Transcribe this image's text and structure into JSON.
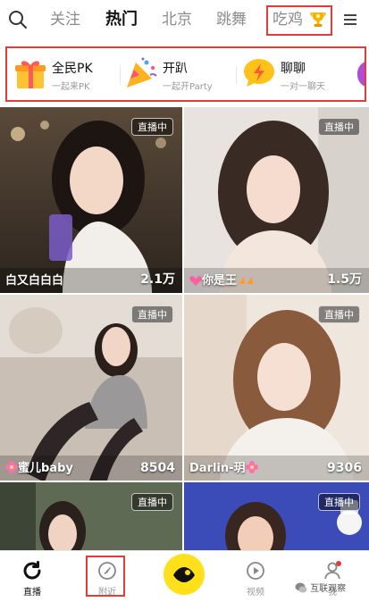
{
  "top_nav": {
    "tabs": [
      {
        "label": "关注"
      },
      {
        "label": "热门",
        "active": true
      },
      {
        "label": "北京"
      },
      {
        "label": "跳舞"
      },
      {
        "label": "吃鸡"
      }
    ],
    "icons": {
      "left": "search-icon",
      "trophy": "trophy-icon",
      "right": "menu-icon"
    },
    "highlight_color": "#e23b3b"
  },
  "categories": [
    {
      "name": "全民PK",
      "subtitle": "一起来PK",
      "icon": "gift-icon"
    },
    {
      "name": "开趴",
      "subtitle": "一起开Party",
      "icon": "party-popper-icon"
    },
    {
      "name": "聊聊",
      "subtitle": "一对一聊天",
      "icon": "lightning-chat-icon"
    }
  ],
  "cards": [
    {
      "badge": "直播中",
      "name": "白又白白白",
      "count": "2.1万"
    },
    {
      "badge": "直播中",
      "name": "你是王",
      "count": "1.5万"
    },
    {
      "badge": "直播中",
      "name": "蜜儿baby",
      "count": "8504"
    },
    {
      "badge": "直播中",
      "name": "Darlin-玥",
      "count": "9306"
    },
    {
      "badge": "直播中",
      "name": "",
      "count": ""
    },
    {
      "badge": "直播中",
      "name": "",
      "count": ""
    }
  ],
  "bottom_nav": {
    "items": [
      {
        "label": "直播",
        "icon": "refresh-icon",
        "active": true
      },
      {
        "label": "附近",
        "icon": "compass-icon"
      },
      {
        "label": "",
        "icon": "eye-logo-icon"
      },
      {
        "label": "视频",
        "icon": "play-icon"
      },
      {
        "label": "我",
        "icon": "user-icon"
      }
    ]
  },
  "watermark": "互联观察",
  "colors": {
    "accent_yellow": "#ffe01b",
    "highlight_red": "#e23b3b"
  }
}
